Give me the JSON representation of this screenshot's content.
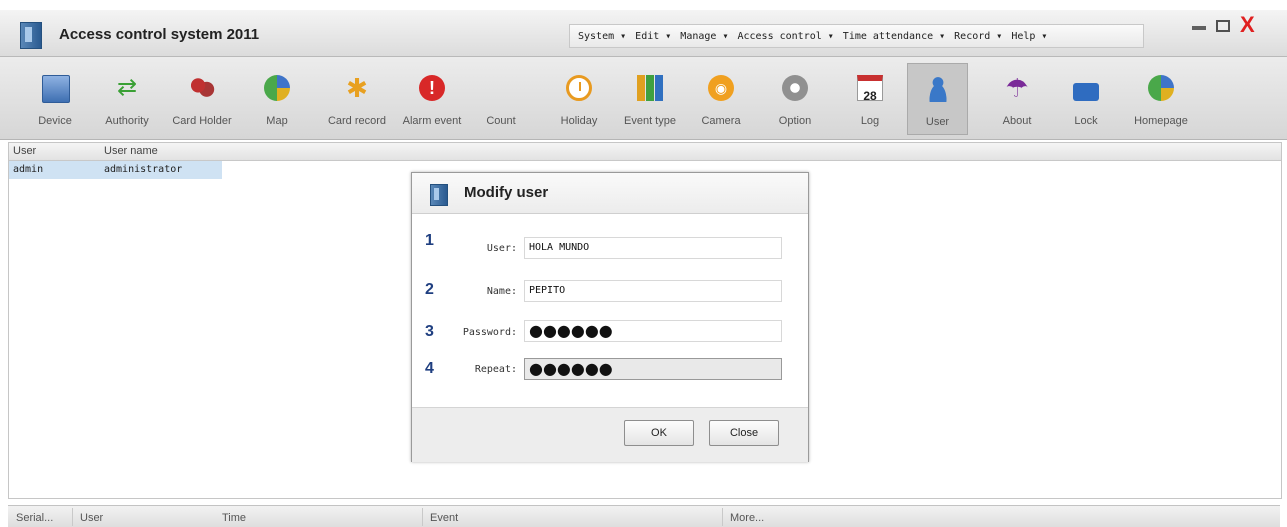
{
  "app": {
    "title": "Access control system 2011"
  },
  "menu": [
    "System ▾",
    "Edit ▾",
    "Manage ▾",
    "Access control ▾",
    "Time attendance ▾",
    "Record ▾",
    "Help ▾"
  ],
  "window_controls": {
    "minimize_icon": "minimize-icon",
    "maximize_icon": "maximize-icon",
    "close_glyph": "X"
  },
  "toolbar": {
    "items": [
      {
        "label": "Device",
        "icon": "device-icon"
      },
      {
        "label": "Authority",
        "icon": "authority-icon"
      },
      {
        "label": "Card Holder",
        "icon": "card-holder-icon"
      },
      {
        "label": "Map",
        "icon": "map-icon"
      },
      {
        "label": "Card record",
        "icon": "card-record-icon"
      },
      {
        "label": "Alarm event",
        "icon": "alarm-event-icon"
      },
      {
        "label": "Count",
        "icon": ""
      },
      {
        "label": "Holiday",
        "icon": "clock-icon"
      },
      {
        "label": "Event type",
        "icon": "bar-chart-icon"
      },
      {
        "label": "Camera",
        "icon": "camera-icon"
      },
      {
        "label": "Option",
        "icon": "gear-icon"
      },
      {
        "label": "Log",
        "icon": "calendar-icon",
        "badge": "28"
      },
      {
        "label": "User",
        "icon": "user-icon",
        "active": true
      },
      {
        "label": "About",
        "icon": "umbrella-icon"
      },
      {
        "label": "Lock",
        "icon": "lock-icon"
      },
      {
        "label": "Homepage",
        "icon": "homepage-icon"
      }
    ]
  },
  "user_table": {
    "columns": [
      "User",
      "User name"
    ],
    "rows": [
      {
        "user": "admin",
        "user_name": "administrator"
      }
    ]
  },
  "dialog": {
    "title": "Modify user",
    "fields": [
      {
        "num": "1",
        "label": "User:",
        "value": "HOLA MUNDO"
      },
      {
        "num": "2",
        "label": "Name:",
        "value": "PEPITO"
      },
      {
        "num": "3",
        "label": "Password:",
        "value": "●●●●●●"
      },
      {
        "num": "4",
        "label": "Repeat:",
        "value": "●●●●●●"
      }
    ],
    "ok_label": "OK",
    "close_label": "Close"
  },
  "bottom_table": {
    "columns": [
      "Serial...",
      "User",
      "Time",
      "Event",
      "More..."
    ]
  }
}
